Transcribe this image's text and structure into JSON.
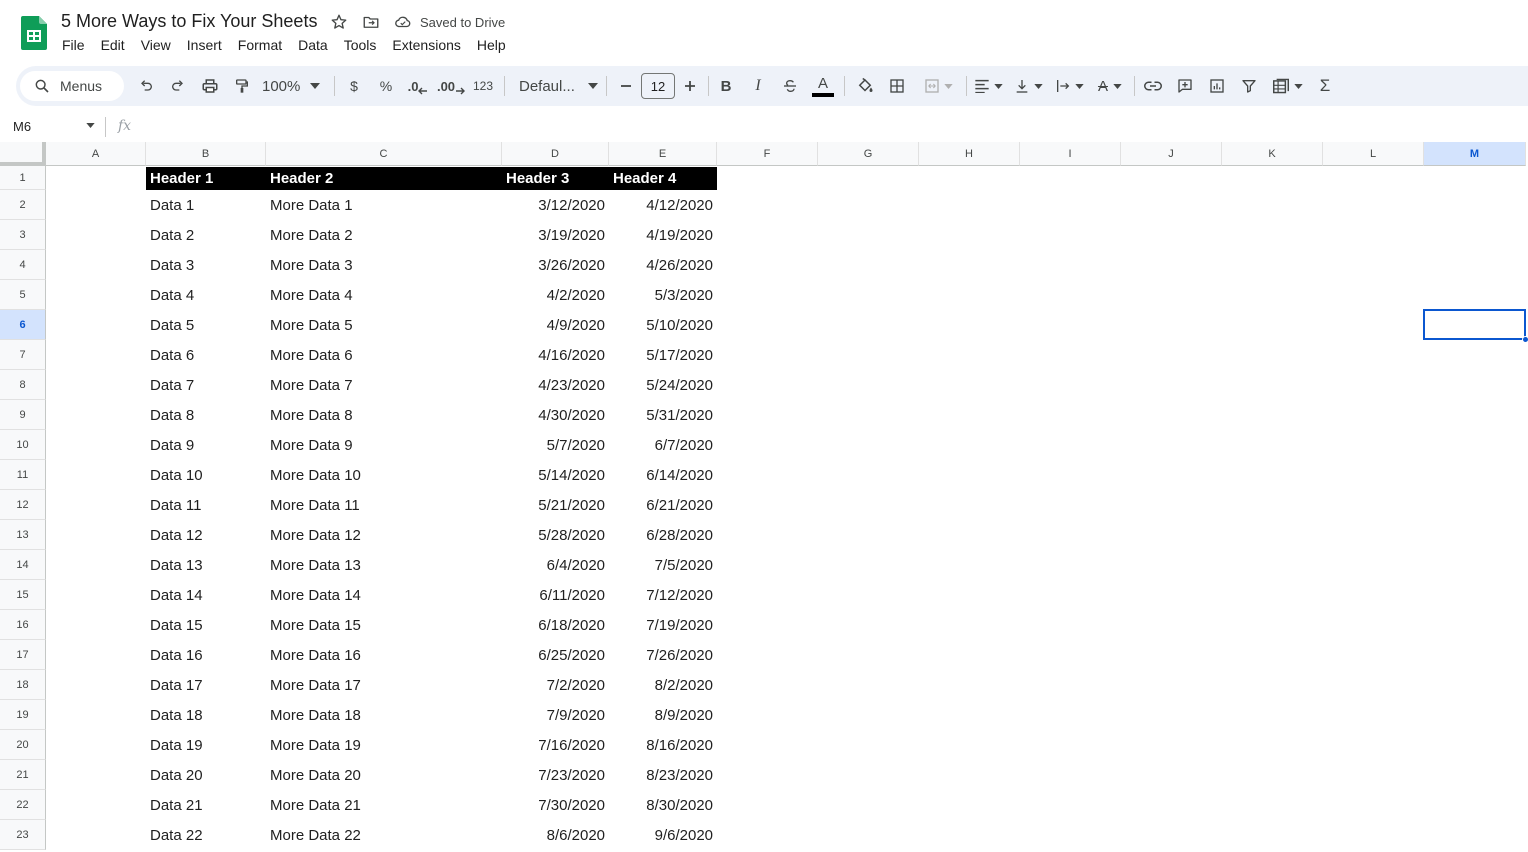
{
  "app": {
    "title": "5 More Ways to Fix Your Sheets",
    "saved_status": "Saved to Drive",
    "logo_icon": "sheets-logo-icon"
  },
  "menu": [
    "File",
    "Edit",
    "View",
    "Insert",
    "Format",
    "Data",
    "Tools",
    "Extensions",
    "Help"
  ],
  "toolbar": {
    "search_label": "Menus",
    "zoom": "100%",
    "currency_label": "$",
    "percent_label": "%",
    "decrease_decimal_label": ".0",
    "increase_decimal_label": ".00",
    "number_format_label": "123",
    "font": "Defaul...",
    "font_size": "12",
    "accent_color": "#0b57d0",
    "text_color": "#000000"
  },
  "formula_bar": {
    "cell_ref": "M6",
    "fx_label": "fx",
    "value": ""
  },
  "sheet": {
    "columns": [
      "A",
      "B",
      "C",
      "D",
      "E",
      "F",
      "G",
      "H",
      "I",
      "J",
      "K",
      "L",
      "M"
    ],
    "selected_column": "M",
    "selected_row": "6",
    "row_numbers": [
      "1",
      "2",
      "3",
      "4",
      "5",
      "6",
      "7",
      "8",
      "9",
      "10",
      "11",
      "12",
      "13",
      "14",
      "15",
      "16",
      "17",
      "18",
      "19",
      "20",
      "21",
      "22",
      "23"
    ],
    "header_row": [
      "Header 1",
      "Header 2",
      "Header 3",
      "Header 4"
    ],
    "rows": [
      [
        "Data 1",
        "More Data 1",
        "3/12/2020",
        "4/12/2020"
      ],
      [
        "Data 2",
        "More Data 2",
        "3/19/2020",
        "4/19/2020"
      ],
      [
        "Data 3",
        "More Data 3",
        "3/26/2020",
        "4/26/2020"
      ],
      [
        "Data 4",
        "More Data 4",
        "4/2/2020",
        "5/3/2020"
      ],
      [
        "Data 5",
        "More Data 5",
        "4/9/2020",
        "5/10/2020"
      ],
      [
        "Data 6",
        "More Data 6",
        "4/16/2020",
        "5/17/2020"
      ],
      [
        "Data 7",
        "More Data 7",
        "4/23/2020",
        "5/24/2020"
      ],
      [
        "Data 8",
        "More Data 8",
        "4/30/2020",
        "5/31/2020"
      ],
      [
        "Data 9",
        "More Data 9",
        "5/7/2020",
        "6/7/2020"
      ],
      [
        "Data 10",
        "More Data 10",
        "5/14/2020",
        "6/14/2020"
      ],
      [
        "Data 11",
        "More Data 11",
        "5/21/2020",
        "6/21/2020"
      ],
      [
        "Data 12",
        "More Data 12",
        "5/28/2020",
        "6/28/2020"
      ],
      [
        "Data 13",
        "More Data 13",
        "6/4/2020",
        "7/5/2020"
      ],
      [
        "Data 14",
        "More Data 14",
        "6/11/2020",
        "7/12/2020"
      ],
      [
        "Data 15",
        "More Data 15",
        "6/18/2020",
        "7/19/2020"
      ],
      [
        "Data 16",
        "More Data 16",
        "6/25/2020",
        "7/26/2020"
      ],
      [
        "Data 17",
        "More Data 17",
        "7/2/2020",
        "8/2/2020"
      ],
      [
        "Data 18",
        "More Data 18",
        "7/9/2020",
        "8/9/2020"
      ],
      [
        "Data 19",
        "More Data 19",
        "7/16/2020",
        "8/16/2020"
      ],
      [
        "Data 20",
        "More Data 20",
        "7/23/2020",
        "8/23/2020"
      ],
      [
        "Data 21",
        "More Data 21",
        "7/30/2020",
        "8/30/2020"
      ],
      [
        "Data 22",
        "More Data 22",
        "8/6/2020",
        "9/6/2020"
      ]
    ]
  }
}
